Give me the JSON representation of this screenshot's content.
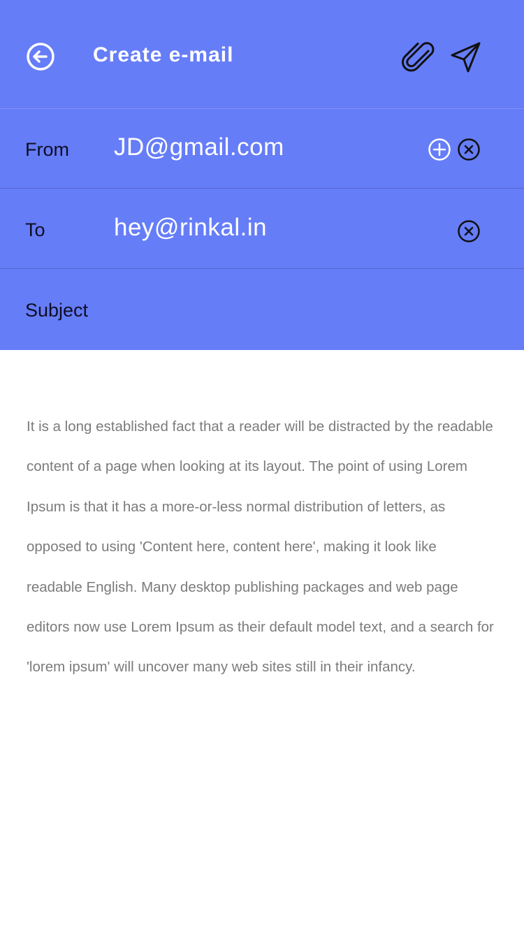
{
  "header": {
    "title": "Create e-mail",
    "icons": {
      "back": "back-arrow-icon",
      "attach": "paperclip-icon",
      "send": "send-icon"
    }
  },
  "fields": {
    "from": {
      "label": "From",
      "value": "JD@gmail.com",
      "icons": [
        "add-circle-icon",
        "close-circle-icon"
      ]
    },
    "to": {
      "label": "To",
      "value": "hey@rinkal.in",
      "icons": [
        "close-circle-icon"
      ]
    },
    "subject": {
      "label": "Subject",
      "value": ""
    }
  },
  "body": {
    "text": "It is a long established fact that a reader will be distracted by the readable content of a page when looking at its layout. The point of using Lorem Ipsum is that it has a more-or-less normal distribution of letters, as opposed to using 'Content here, content here', making it look like readable English. Many desktop publishing packages and web page editors now use Lorem Ipsum as their default model text, and a search for 'lorem ipsum' will uncover many web sites still in their infancy."
  },
  "colors": {
    "header_bg": "#667df8",
    "label_text": "#0e0e22",
    "body_text": "#7b7b7b",
    "white": "#ffffff"
  }
}
